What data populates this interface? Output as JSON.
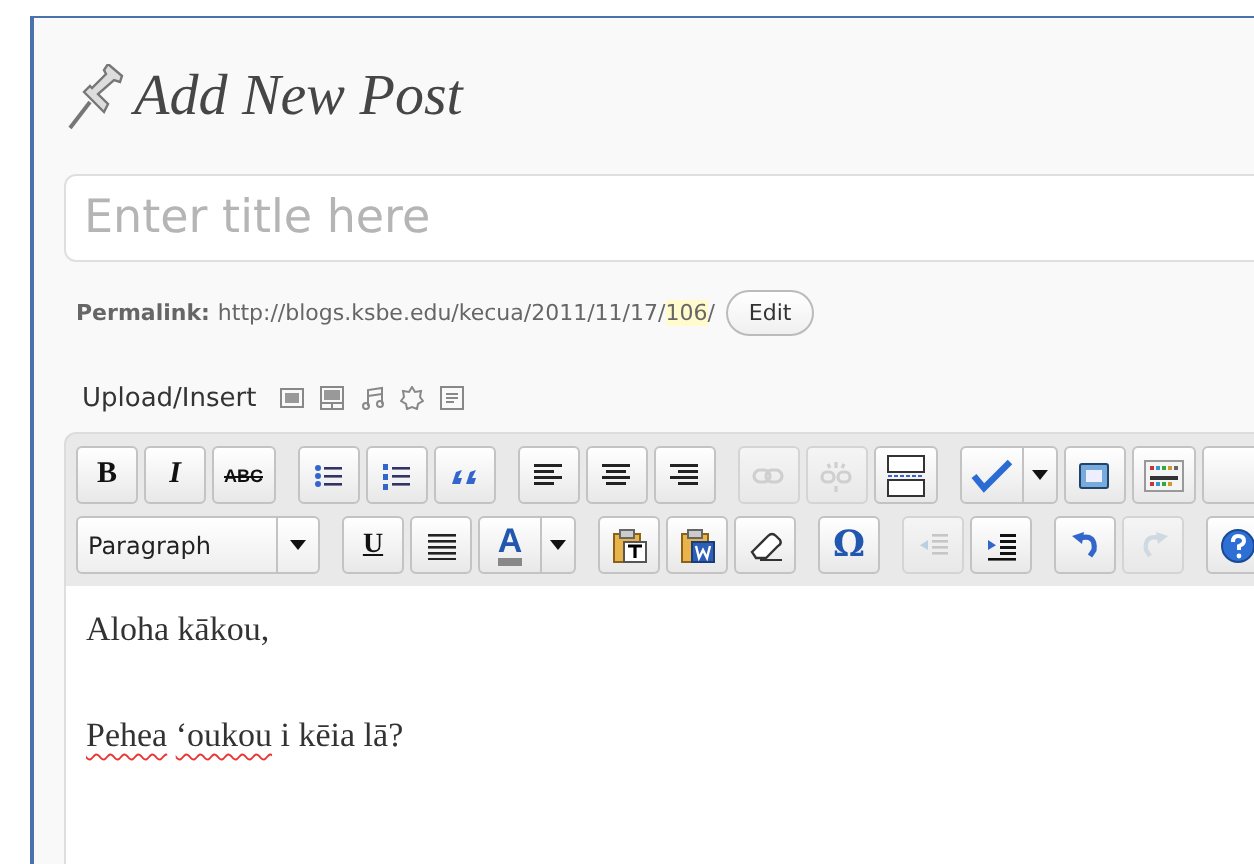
{
  "heading": {
    "title": "Add New Post"
  },
  "title_field": {
    "placeholder": "Enter title here"
  },
  "permalink": {
    "label": "Permalink:",
    "url_base": "http://blogs.ksbe.edu/kecua/2011/11/17/",
    "slug": "106",
    "url_end": "/",
    "edit_button": "Edit"
  },
  "upload_insert": {
    "label": "Upload/Insert"
  },
  "toolbar_rows": [
    [
      [
        {
          "kind": "text",
          "label": "B",
          "disabled": false
        },
        {
          "kind": "text",
          "label": "I",
          "disabled": false
        },
        {
          "kind": "text",
          "label": "ABC",
          "disabled": false
        }
      ],
      [
        {
          "kind": "icon",
          "disabled": false
        },
        {
          "kind": "icon",
          "disabled": false
        },
        {
          "kind": "icon",
          "disabled": false
        }
      ],
      [
        {
          "kind": "icon",
          "disabled": false
        },
        {
          "kind": "icon",
          "disabled": false
        },
        {
          "kind": "icon",
          "disabled": false
        }
      ],
      [
        {
          "kind": "icon",
          "disabled": true
        },
        {
          "kind": "icon",
          "disabled": true
        },
        {
          "kind": "icon",
          "disabled": false
        }
      ],
      [
        {
          "kind": "split",
          "disabled": false
        },
        {
          "kind": "icon",
          "disabled": false
        },
        {
          "kind": "icon",
          "disabled": false
        },
        {
          "kind": "icon",
          "disabled": false
        }
      ]
    ],
    [
      [
        {
          "kind": "select",
          "label": "Paragraph",
          "disabled": false
        }
      ],
      [
        {
          "kind": "text",
          "label": "U",
          "disabled": false
        },
        {
          "kind": "icon",
          "disabled": false
        },
        {
          "kind": "color",
          "label": "A",
          "disabled": false
        }
      ],
      [
        {
          "kind": "icon",
          "disabled": false
        },
        {
          "kind": "icon",
          "disabled": false
        },
        {
          "kind": "icon",
          "disabled": false
        }
      ],
      [
        {
          "kind": "text",
          "label": "Ω",
          "disabled": false
        }
      ],
      [
        {
          "kind": "icon",
          "disabled": true
        },
        {
          "kind": "icon",
          "disabled": false
        }
      ],
      [
        {
          "kind": "icon",
          "disabled": false
        },
        {
          "kind": "icon",
          "disabled": true
        }
      ],
      [
        {
          "kind": "icon",
          "disabled": false
        }
      ]
    ]
  ],
  "content": [
    {
      "segments": [
        {
          "text": "Aloha kākou,",
          "misspelled": false
        }
      ]
    },
    {
      "segments": [
        {
          "text": "Pehea",
          "misspelled": true
        },
        {
          "text": "‘oukou",
          "misspelled": true
        },
        {
          "text": "i kēia lā?",
          "misspelled": false
        }
      ]
    }
  ]
}
